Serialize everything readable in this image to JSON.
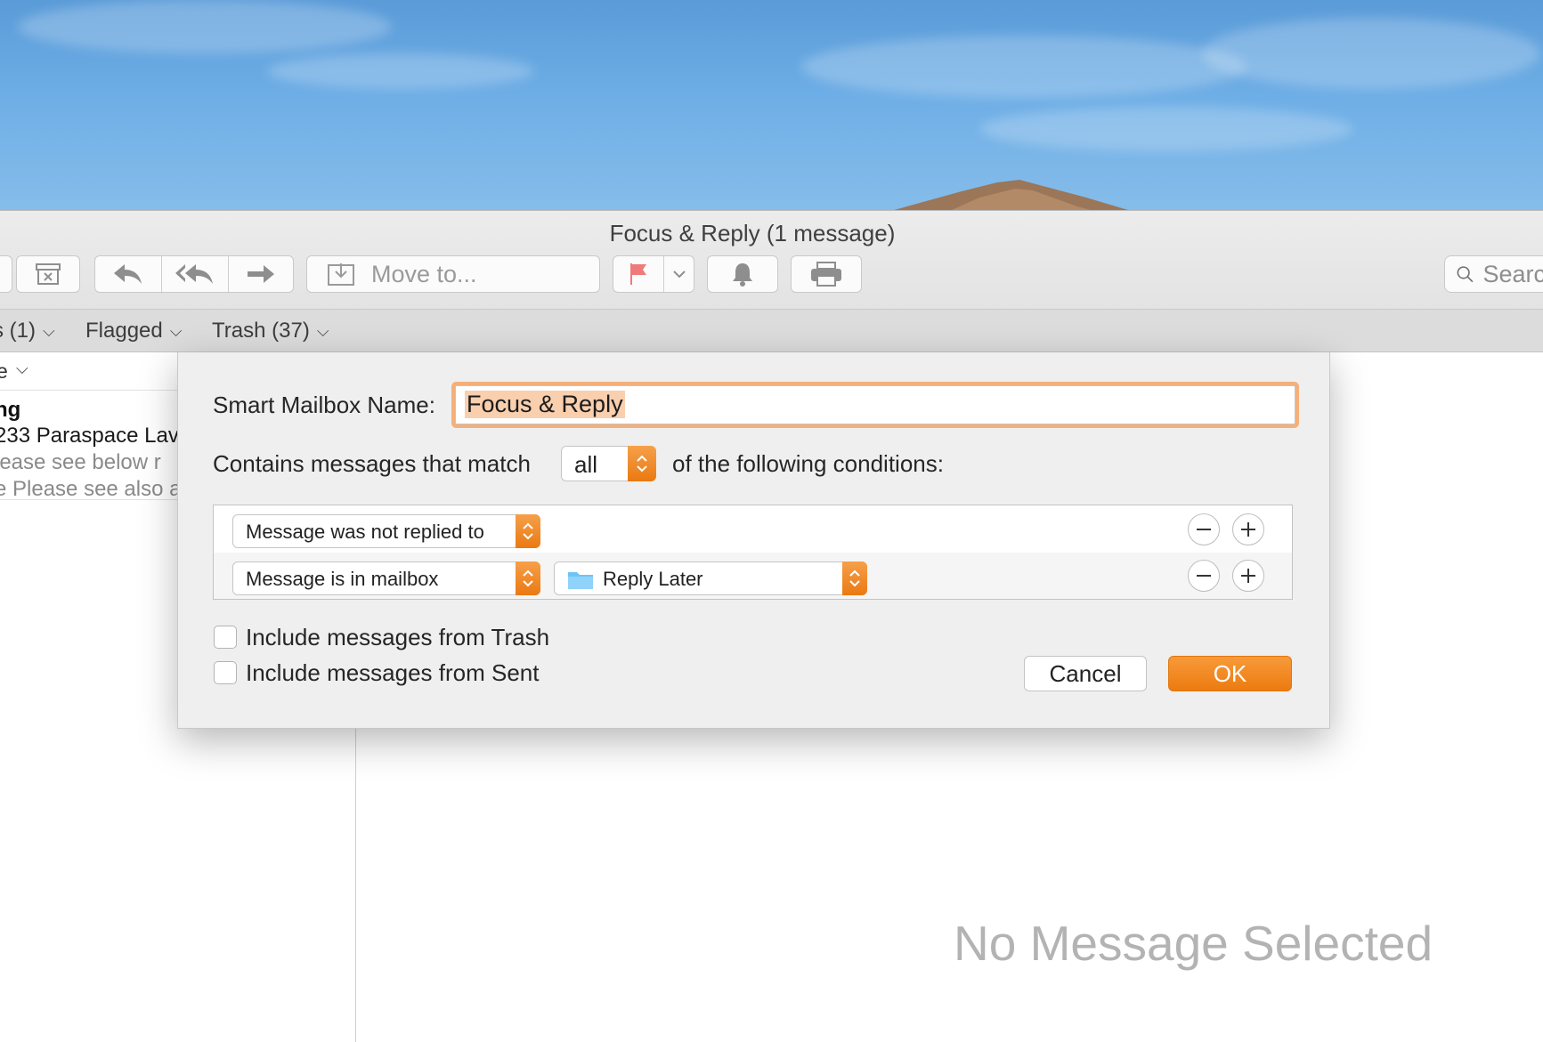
{
  "window": {
    "title": "Focus & Reply (1 message)"
  },
  "toolbar": {
    "move_to_label": "Move to...",
    "search_placeholder": "Search"
  },
  "favorites_bar": {
    "items": [
      {
        "label": "s (1)"
      },
      {
        "label": "Flagged"
      },
      {
        "label": "Trash (37)"
      }
    ]
  },
  "message_list": {
    "sort_label": "e",
    "message": {
      "sender": "ng",
      "subject": "233 Paraspace Lav",
      "preview_line1": "lease see below r",
      "preview_line2": "e Please see also a"
    }
  },
  "reading_pane": {
    "empty_text": "No Message Selected"
  },
  "dialog": {
    "name_label": "Smart Mailbox Name:",
    "name_value": "Focus & Reply",
    "match_prefix": "Contains messages that match",
    "match_value": "all",
    "match_suffix": "of the following conditions:",
    "conditions": [
      {
        "criterion": "Message was not replied to"
      },
      {
        "criterion": "Message is in mailbox",
        "mailbox": "Reply Later"
      }
    ],
    "include_trash_label": "Include messages from Trash",
    "include_trash_checked": false,
    "include_sent_label": "Include messages from Sent",
    "include_sent_checked": false,
    "cancel_label": "Cancel",
    "ok_label": "OK"
  },
  "colors": {
    "accent": "#ec7b10",
    "focus_ring": "#f4b07a",
    "selection": "#f9cfae",
    "flag": "#f07a7a",
    "folder": "#6ec3f5"
  }
}
